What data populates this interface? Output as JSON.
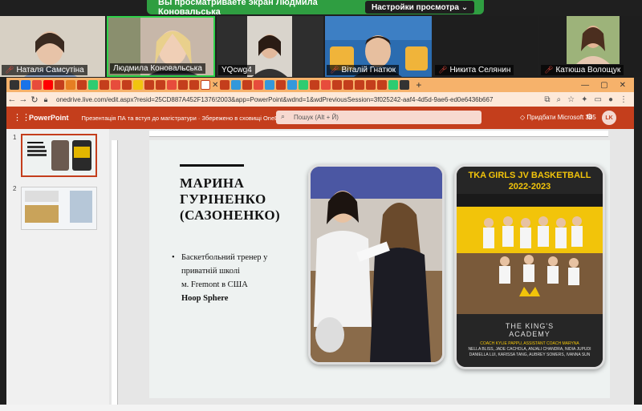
{
  "zoom": {
    "share_banner": "Вы просматриваете экран Людмила Коновальська",
    "view_options_button": "Настройки просмотра",
    "participants": [
      {
        "name": "Наталя Самсутіна"
      },
      {
        "name": "Людмила Коновальська"
      },
      {
        "name": "YQcwg4"
      },
      {
        "name": "Віталій Гнатюк"
      },
      {
        "name": "Никита Селянин"
      },
      {
        "name": "Катюша Волощук"
      }
    ]
  },
  "browser": {
    "url": "onedrive.live.com/edit.aspx?resid=25CD887A452F1376!2003&app=PowerPoint&wdnd=1&wdPreviousSession=3f025242-aaf4-4d5d-9ae6-ed0e6436b667"
  },
  "powerpoint": {
    "app_name": "PowerPoint",
    "doc_title": "Презентація ПА та вступ до магістратури  ·  Збережено в сховищі OneDrive ⌄",
    "search_placeholder": "Пошук (Alt + Й)",
    "buy_label": "Придбати Microsoft 365",
    "avatar_initials": "LK",
    "slide_numbers": [
      "1",
      "2"
    ]
  },
  "slide": {
    "name_line1": "МАРИНА",
    "name_line2": "ГУРІНЕНКО",
    "name_line3": "(САЗОНЕНКО)",
    "bullet_1": "Баскетбольний тренер у",
    "bullet_2": "приватній школі",
    "bullet_3": "м. Fremont в США",
    "bullet_4": "Hoop Sphere",
    "poster_title_1": "TKA GIRLS JV BASKETBALL",
    "poster_title_2": "2022-2023",
    "poster_school_1": "THE KING'S",
    "poster_school_2": "ACADEMY",
    "poster_coach": "COACH KYLIE PAPPU, ASSISTANT COACH MARYNA",
    "poster_team_1": "NELLA BLISS, JADE CACHOLA, ANJALI CHANDRA, NIDIA JUPUDI",
    "poster_team_2": "DANIELLA LUI, KARISSA TANG, AUBREY SOMERS, IVANNA SUN"
  },
  "colors": {
    "zoom_green": "#2f9e41",
    "ppt_red": "#c43e1c",
    "tab_orange": "#f6b26b",
    "poster_yellow": "#f2c40a"
  }
}
